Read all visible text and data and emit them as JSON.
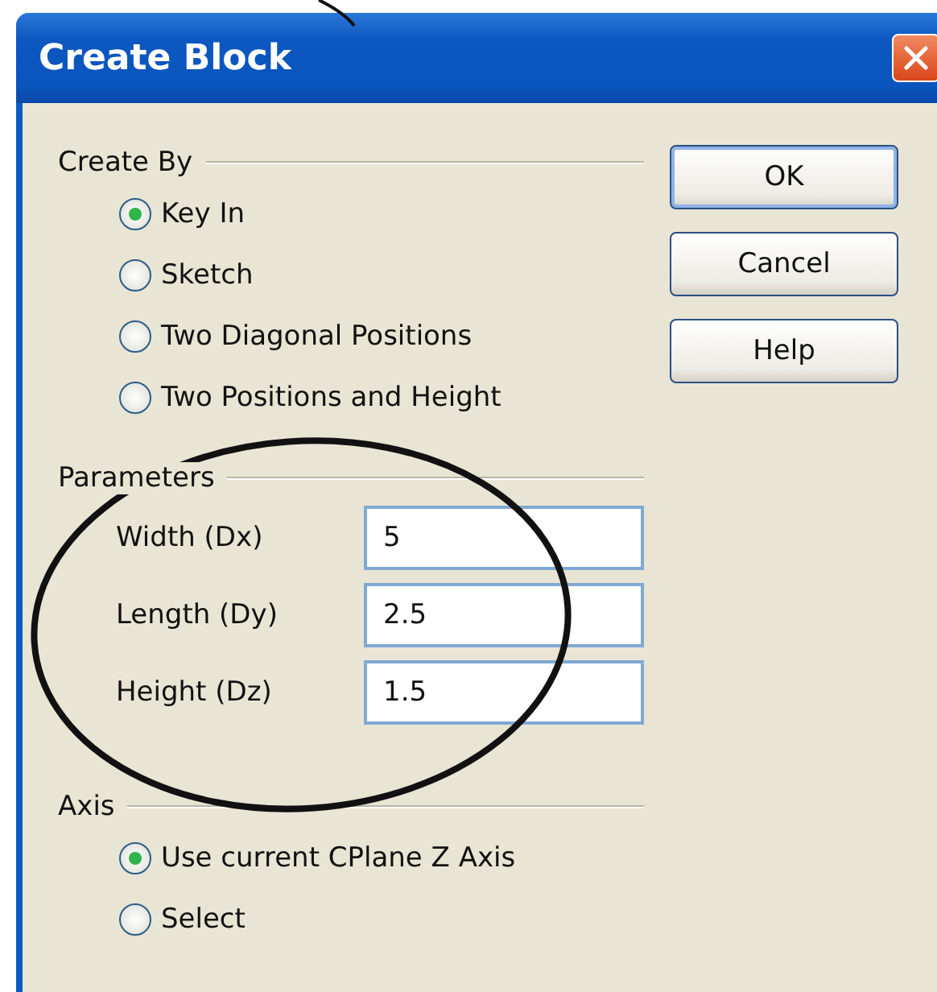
{
  "window": {
    "title": "Create Block"
  },
  "create_by": {
    "label": "Create By",
    "options": [
      {
        "label": "Key In",
        "selected": true
      },
      {
        "label": "Sketch",
        "selected": false
      },
      {
        "label": "Two Diagonal Positions",
        "selected": false
      },
      {
        "label": "Two Positions and Height",
        "selected": false
      }
    ]
  },
  "parameters": {
    "label": "Parameters",
    "fields": [
      {
        "label": "Width (Dx)",
        "value": "5"
      },
      {
        "label": "Length (Dy)",
        "value": "2.5"
      },
      {
        "label": "Height (Dz)",
        "value": "1.5"
      }
    ]
  },
  "axis": {
    "label": "Axis",
    "options": [
      {
        "label": "Use current CPlane Z Axis",
        "selected": true
      },
      {
        "label": "Select",
        "selected": false
      }
    ]
  },
  "buttons": [
    {
      "label": "OK",
      "default": true
    },
    {
      "label": "Cancel",
      "default": false
    },
    {
      "label": "Help",
      "default": false
    }
  ]
}
